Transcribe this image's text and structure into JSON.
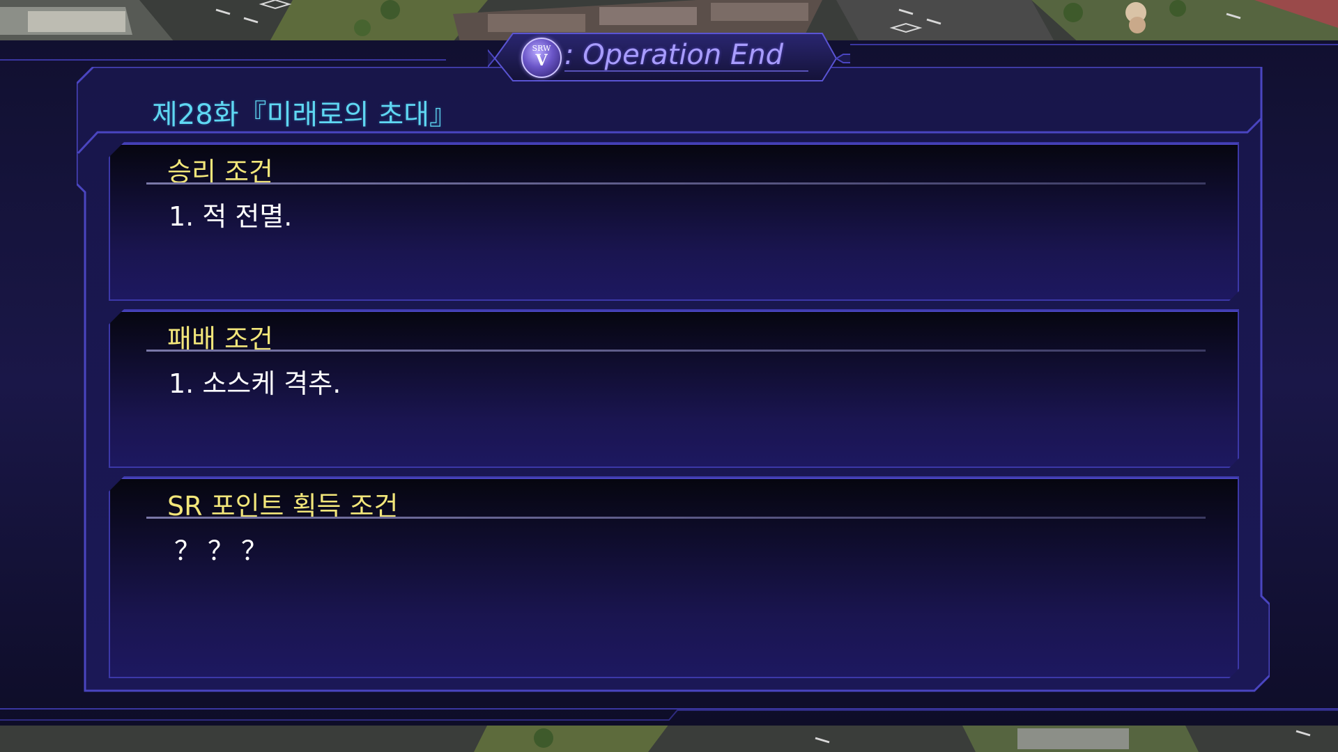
{
  "header": {
    "logo_text_top": "SRW",
    "logo_text_main": "V",
    "title": ": Operation End"
  },
  "chapter": {
    "title": "제28화『미래로의 초대』"
  },
  "conditions": [
    {
      "heading": "승리 조건",
      "item": "1. 적 전멸."
    },
    {
      "heading": "패배 조건",
      "item": "1. 소스케 격추."
    },
    {
      "heading": "SR 포인트 획득 조건",
      "item": "？？？"
    }
  ],
  "colors": {
    "chapter_title": "#5fd7f2",
    "condition_heading": "#f2e67a",
    "header_title": "#a89cff",
    "frame_line": "#4a45c0"
  }
}
